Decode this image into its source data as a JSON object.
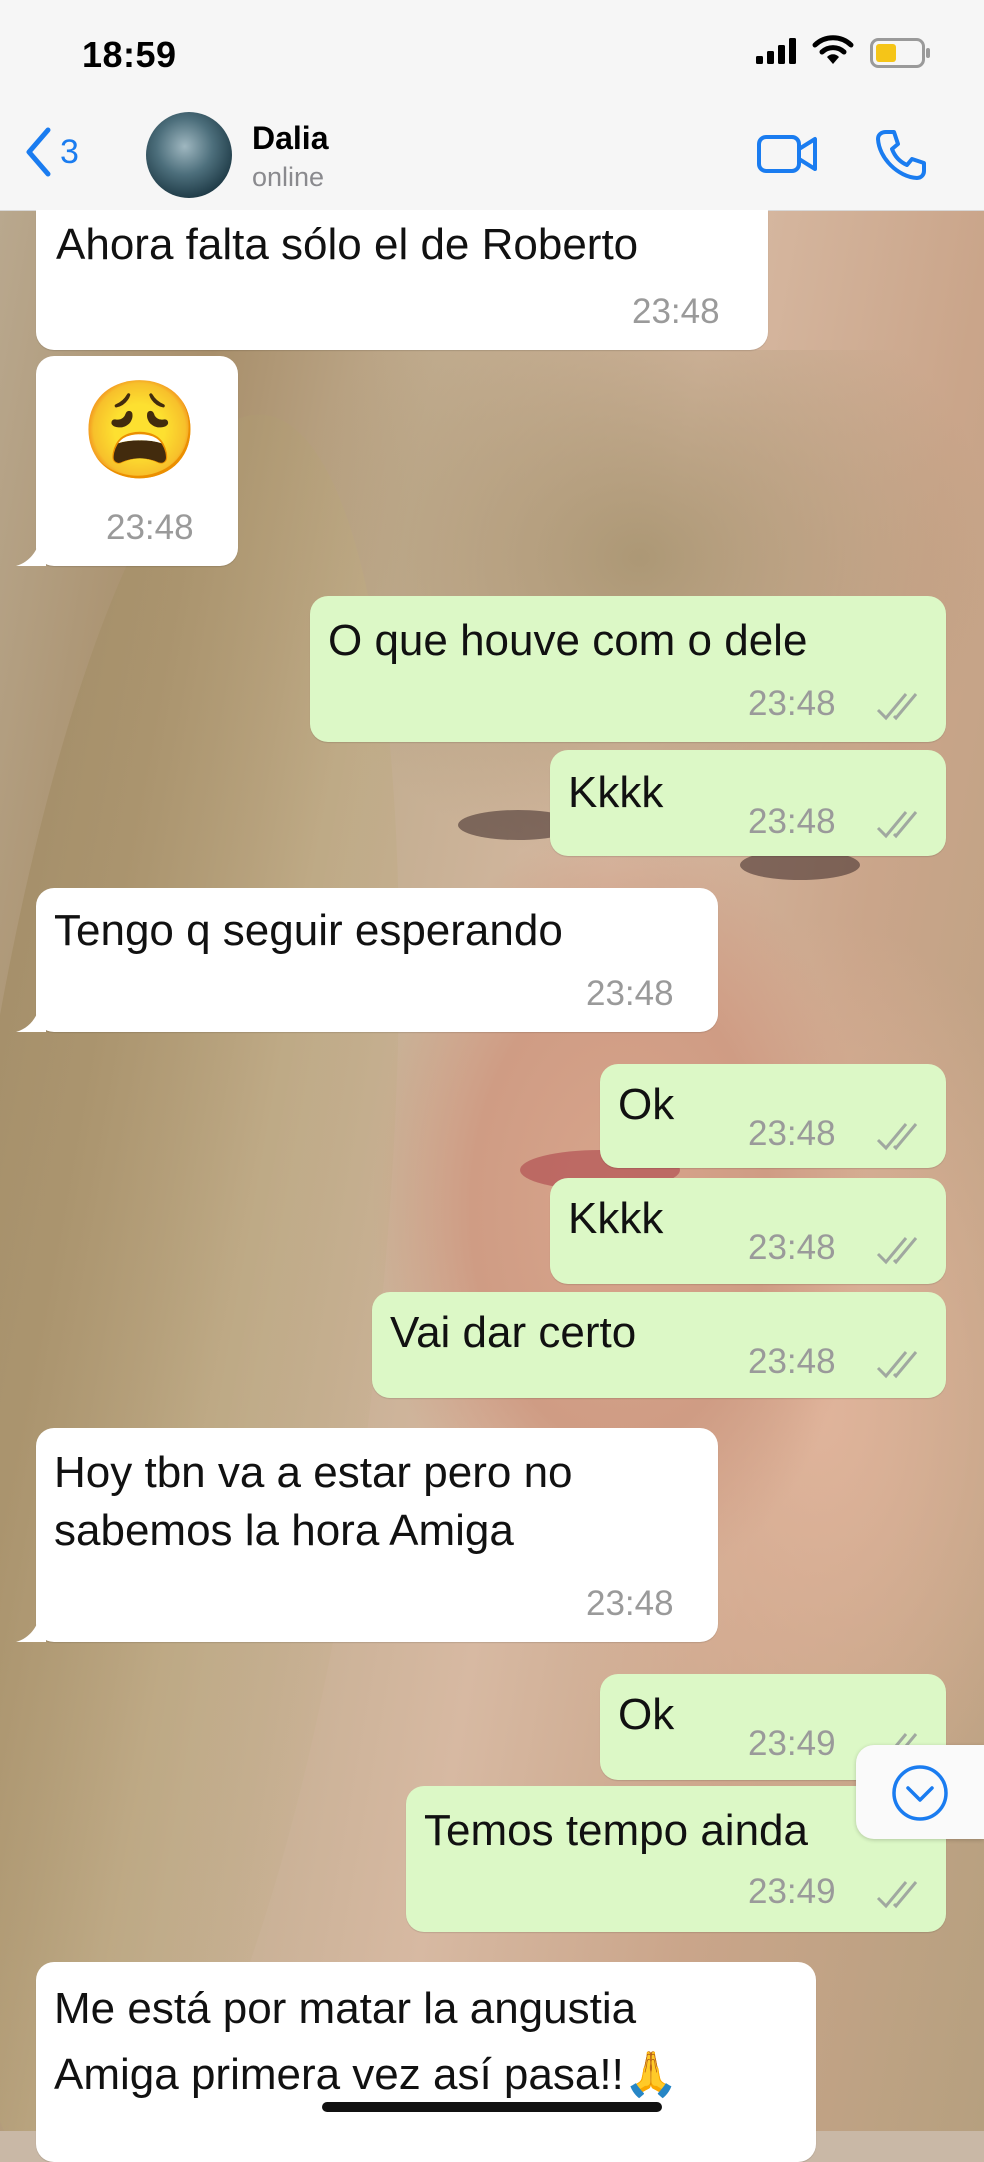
{
  "status_bar": {
    "time": "18:59",
    "icons": [
      "signal-icon",
      "wifi-icon",
      "battery-icon"
    ]
  },
  "header": {
    "back_count": "3",
    "contact_name": "Dalia",
    "contact_status": "online",
    "icons": [
      "chevron-left-icon",
      "video-camera-icon",
      "phone-icon"
    ]
  },
  "messages": [
    {
      "direction": "incoming",
      "text": "Ahora falta sólo el de Roberto",
      "time": "23:48"
    },
    {
      "direction": "incoming",
      "text": "😩",
      "time": "23:48"
    },
    {
      "direction": "outgoing",
      "text": "O que houve com o dele",
      "time": "23:48",
      "status": "read"
    },
    {
      "direction": "outgoing",
      "text": "Kkkk",
      "time": "23:48",
      "status": "read"
    },
    {
      "direction": "incoming",
      "text": "Tengo q seguir esperando",
      "time": "23:48"
    },
    {
      "direction": "outgoing",
      "text": "Ok",
      "time": "23:48",
      "status": "read"
    },
    {
      "direction": "outgoing",
      "text": "Kkkk",
      "time": "23:48",
      "status": "read"
    },
    {
      "direction": "outgoing",
      "text": "Vai dar certo",
      "time": "23:48",
      "status": "read"
    },
    {
      "direction": "incoming",
      "text": "Hoy tbn va a estar pero no\nsabemos la hora Amiga",
      "time": "23:48"
    },
    {
      "direction": "outgoing",
      "text": "Ok",
      "time": "23:49",
      "status": "read"
    },
    {
      "direction": "outgoing",
      "text": "Temos tempo ainda",
      "time": "23:49",
      "status": "read"
    },
    {
      "direction": "incoming",
      "text": "Me está por matar la angustia\nAmiga primera vez así pasa!!🙏"
    }
  ],
  "colors": {
    "outgoing_bubble": "#dcf8c6",
    "incoming_bubble": "#ffffff",
    "accent": "#1a7cf0",
    "read_ticks": "#a0a8a0"
  },
  "scroll_button_icon": "chevron-down-circle-icon"
}
